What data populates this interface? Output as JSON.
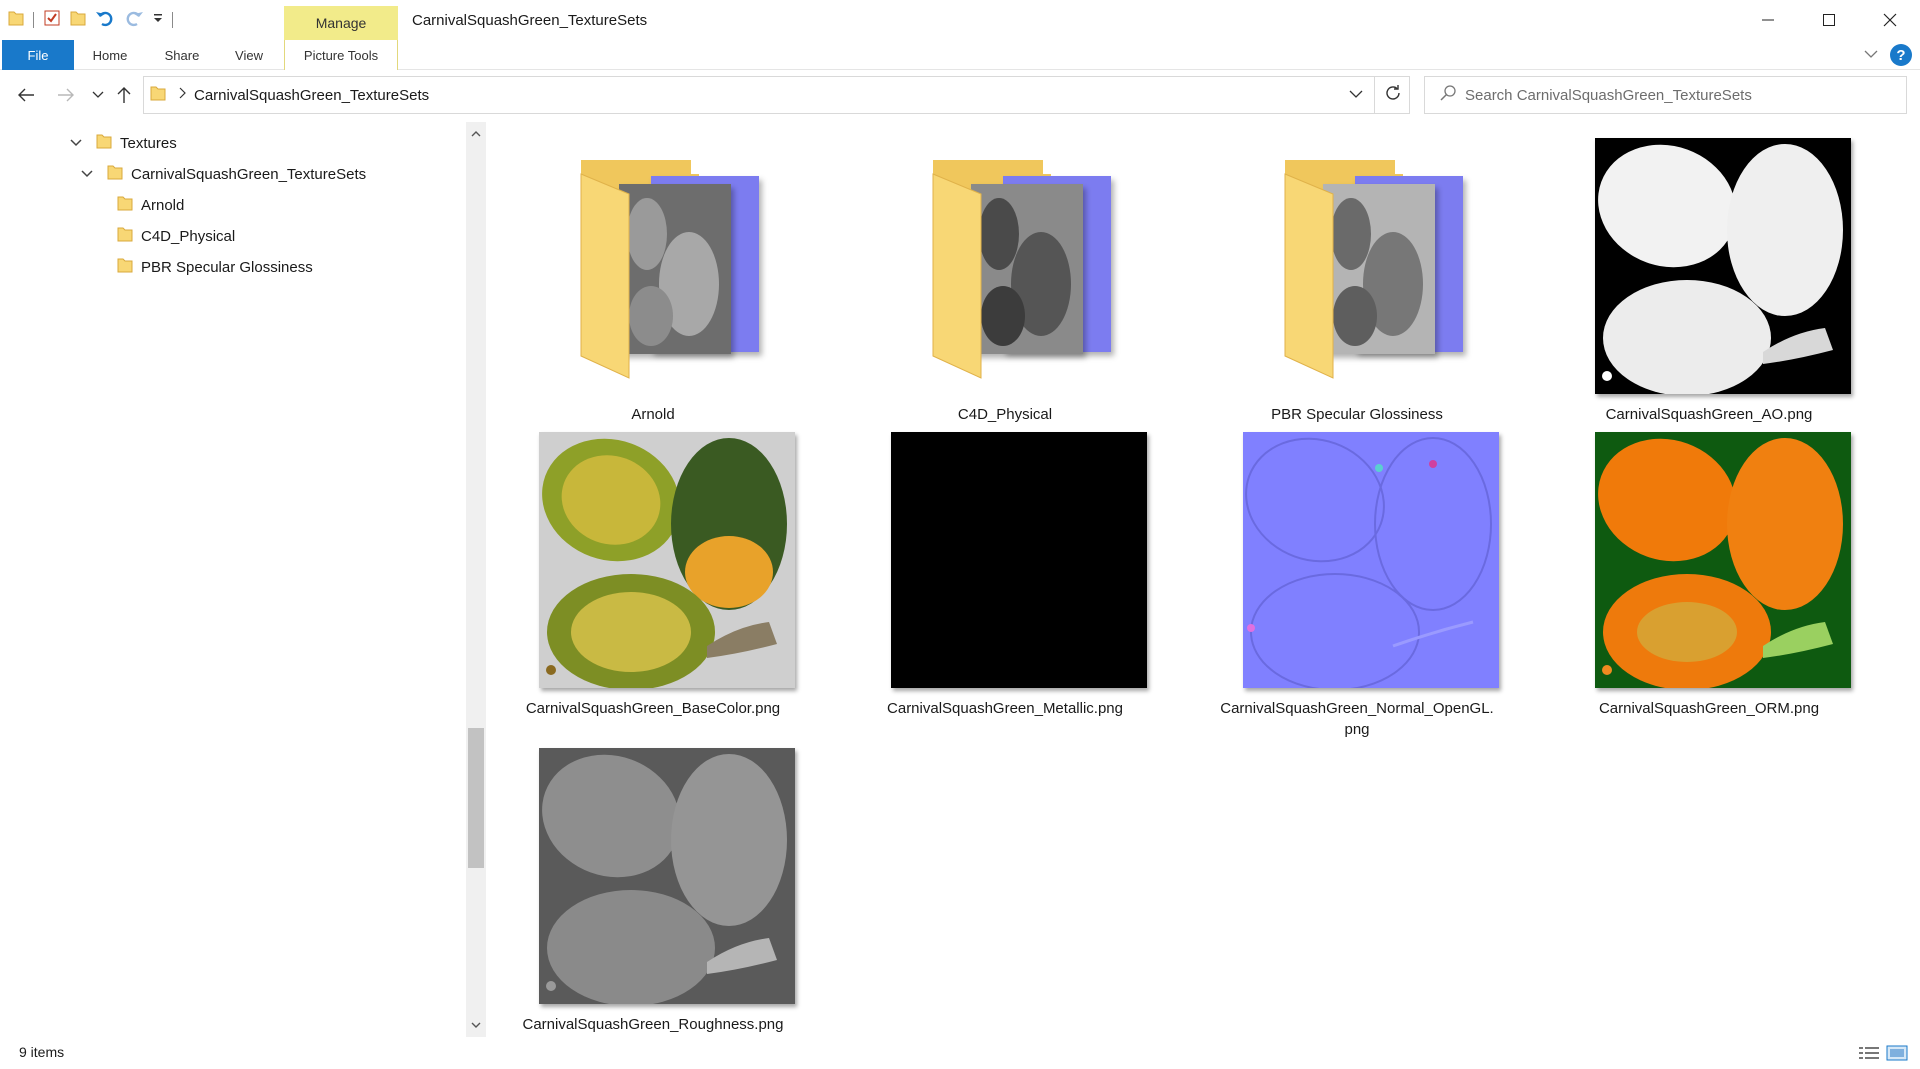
{
  "window": {
    "title": "CarnivalSquashGreen_TextureSets",
    "context_tab_group": "Manage",
    "buttons": [
      "minimize-icon",
      "maximize-icon",
      "close-icon"
    ]
  },
  "ribbon": {
    "tabs": [
      "File",
      "Home",
      "Share",
      "View"
    ],
    "context_tab": "Picture Tools"
  },
  "address": {
    "breadcrumb": [
      "CarnivalSquashGreen_TextureSets"
    ],
    "search_placeholder": "Search CarnivalSquashGreen_TextureSets"
  },
  "tree": [
    {
      "label": "Textures",
      "expanded": true
    },
    {
      "label": "CarnivalSquashGreen_TextureSets",
      "expanded": true
    },
    {
      "label": "Arnold"
    },
    {
      "label": "C4D_Physical"
    },
    {
      "label": "PBR Specular Glossiness"
    }
  ],
  "items": [
    {
      "name": "Arnold",
      "kind": "folder"
    },
    {
      "name": "C4D_Physical",
      "kind": "folder"
    },
    {
      "name": "PBR Specular Glossiness",
      "kind": "folder"
    },
    {
      "name": "CarnivalSquashGreen_AO.png",
      "kind": "image",
      "style": "ao"
    },
    {
      "name": "CarnivalSquashGreen_BaseColor.png",
      "kind": "image",
      "style": "basecolor"
    },
    {
      "name": "CarnivalSquashGreen_Metallic.png",
      "kind": "image",
      "style": "metallic"
    },
    {
      "name_line1": "CarnivalSquashGreen_Normal_OpenGL.",
      "name_line2": "png",
      "kind": "image",
      "style": "normal"
    },
    {
      "name": "CarnivalSquashGreen_ORM.png",
      "kind": "image",
      "style": "orm"
    },
    {
      "name": "CarnivalSquashGreen_Roughness.png",
      "kind": "image",
      "style": "roughness"
    }
  ],
  "status": {
    "item_count": "9 items"
  },
  "colors": {
    "file_tab": "#1979ca",
    "manage_tab": "#f2eb8a",
    "folder": "#f8d775",
    "normal_map": "#8080ff"
  }
}
